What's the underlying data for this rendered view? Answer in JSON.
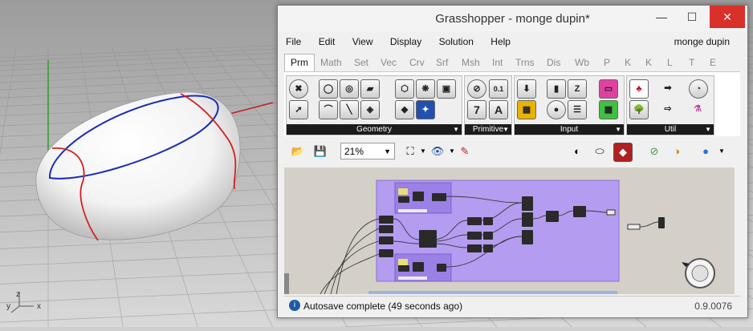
{
  "viewport": {
    "axes": {
      "y_label": "y",
      "z_label": "z",
      "x_label": "x"
    }
  },
  "window": {
    "title": "Grasshopper - monge dupin*",
    "controls": {
      "minimize": "—",
      "maximize": "☐",
      "close": "✕"
    }
  },
  "menu": {
    "items": [
      "File",
      "Edit",
      "View",
      "Display",
      "Solution",
      "Help"
    ],
    "doc_name": "monge dupin"
  },
  "tabs": [
    "Prm",
    "Math",
    "Set",
    "Vec",
    "Crv",
    "Srf",
    "Msh",
    "Int",
    "Trns",
    "Dis",
    "Wb",
    "P",
    "K",
    "K",
    "L",
    "T",
    "E"
  ],
  "active_tab": "Prm",
  "ribbon": {
    "groups": [
      {
        "label": "Geometry",
        "icon": "component-group-icon"
      },
      {
        "label": "Primitive",
        "icon": "primitive-group-icon",
        "glyphs": [
          "0.1",
          "7",
          "A"
        ]
      },
      {
        "label": "Input",
        "icon": "input-group-icon"
      },
      {
        "label": "Util",
        "icon": "util-group-icon"
      }
    ]
  },
  "toolbar": {
    "zoom": "21%"
  },
  "status": {
    "icon": "info-icon",
    "text": "Autosave complete (49 seconds ago)",
    "version": "0.9.0076"
  },
  "colors": {
    "canvas_bg": "#d4d0c8",
    "group_fill": "#b49cf0",
    "close_button": "#d9302a",
    "viewport_bg": "#c8c8c8",
    "curve_red": "#d42020",
    "curve_blue": "#1a2bb8"
  }
}
